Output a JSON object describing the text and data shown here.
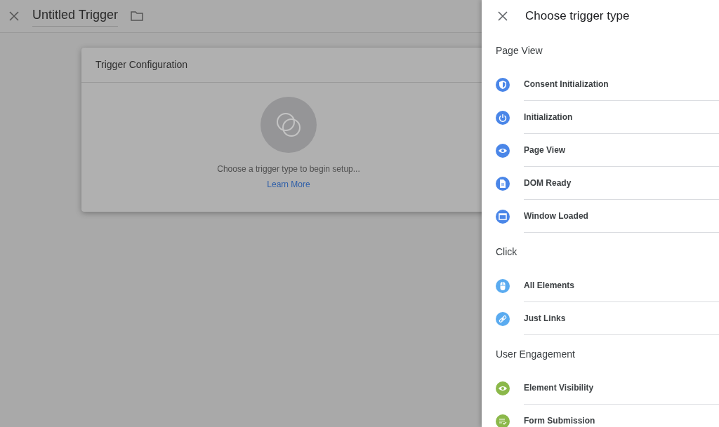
{
  "header": {
    "title": "Untitled Trigger"
  },
  "card": {
    "title": "Trigger Configuration",
    "message": "Choose a trigger type to begin setup...",
    "link": "Learn More"
  },
  "panel": {
    "title": "Choose trigger type",
    "sections": [
      {
        "heading": "Page View",
        "items": [
          {
            "label": "Consent Initialization",
            "color": "#4a86e8"
          },
          {
            "label": "Initialization",
            "color": "#4a86e8"
          },
          {
            "label": "Page View",
            "color": "#4a86e8"
          },
          {
            "label": "DOM Ready",
            "color": "#4a86e8"
          },
          {
            "label": "Window Loaded",
            "color": "#4a86e8"
          }
        ]
      },
      {
        "heading": "Click",
        "items": [
          {
            "label": "All Elements",
            "color": "#5aabf0"
          },
          {
            "label": "Just Links",
            "color": "#5aabf0"
          }
        ]
      },
      {
        "heading": "User Engagement",
        "items": [
          {
            "label": "Element Visibility",
            "color": "#8bb84a"
          },
          {
            "label": "Form Submission",
            "color": "#8bb84a"
          }
        ]
      }
    ]
  }
}
